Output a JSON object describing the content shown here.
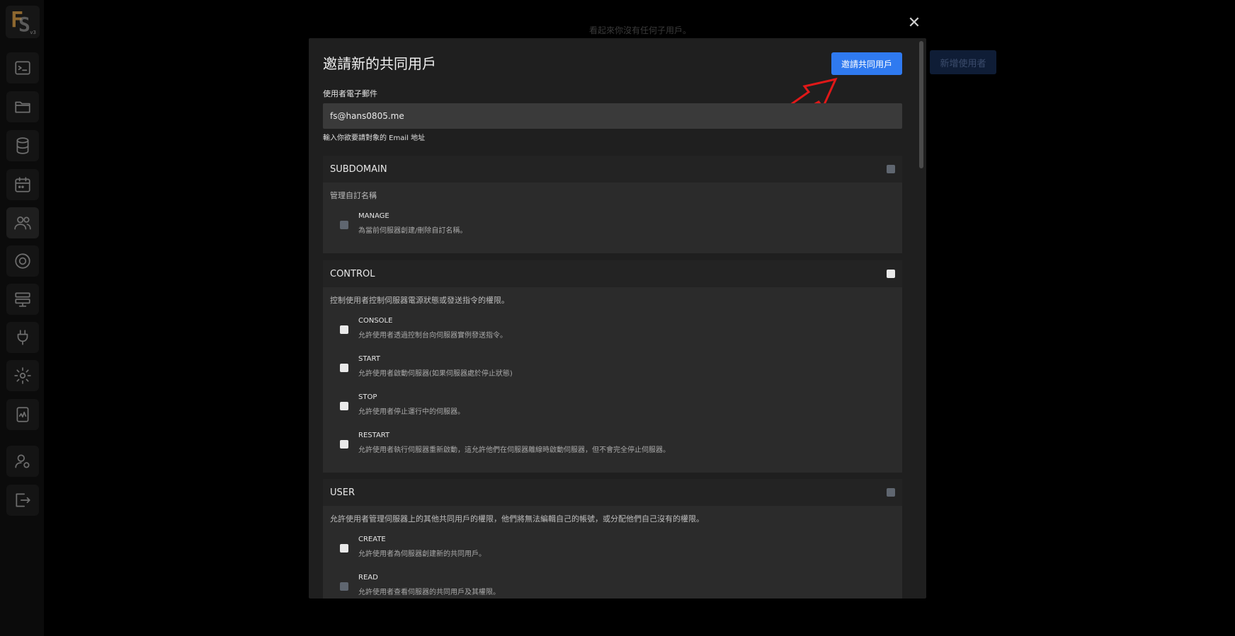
{
  "background": {
    "notice": "看起來你沒有任何子用戶。",
    "add_user_button": "新增使用者"
  },
  "logo": {
    "version": "v3"
  },
  "sidebar": {
    "items": [
      {
        "icon": "terminal-icon"
      },
      {
        "icon": "folder-icon"
      },
      {
        "icon": "database-icon"
      },
      {
        "icon": "calendar-icon"
      },
      {
        "icon": "users-icon"
      },
      {
        "icon": "backup-icon"
      },
      {
        "icon": "network-icon"
      },
      {
        "icon": "plug-icon"
      },
      {
        "icon": "gear-icon"
      },
      {
        "icon": "activity-icon"
      },
      {
        "icon": "account-settings-icon"
      },
      {
        "icon": "logout-icon"
      }
    ]
  },
  "modal": {
    "close_label": "✕",
    "title": "邀請新的共同用戶",
    "invite_button": "邀請共同用戶",
    "email_label": "使用者電子郵件",
    "email_value": "fs@hans0805.me",
    "email_help": "輸入你欲要請對象的 Email 地址",
    "sections": {
      "subdomain": {
        "title": "SUBDOMAIN",
        "desc": "管理自訂名稱",
        "perms": [
          {
            "name": "MANAGE",
            "desc": "為當前伺服器創建/刪除自訂名稱。"
          }
        ]
      },
      "control": {
        "title": "CONTROL",
        "desc": "控制使用者控制伺服器電源狀態或發送指令的權限。",
        "perms": [
          {
            "name": "CONSOLE",
            "desc": "允許使用者透過控制台向伺服器實例發送指令。"
          },
          {
            "name": "START",
            "desc": "允許使用者啟動伺服器(如果伺服器處於停止狀態)"
          },
          {
            "name": "STOP",
            "desc": "允許使用者停止運行中的伺服器。"
          },
          {
            "name": "RESTART",
            "desc": "允許使用者執行伺服器重新啟動，這允許他們在伺服器離線時啟動伺服器，但不會完全停止伺服器。"
          }
        ]
      },
      "user": {
        "title": "USER",
        "desc": "允許使用者管理伺服器上的其他共同用戶的權限，他們將無法編輯自己的帳號，或分配他們自己沒有的權限。",
        "perms": [
          {
            "name": "CREATE",
            "desc": "允許使用者為伺服器創建新的共同用戶。"
          },
          {
            "name": "READ",
            "desc": "允許使用者查看伺服器的共同用戶及其權限。"
          }
        ]
      }
    }
  }
}
